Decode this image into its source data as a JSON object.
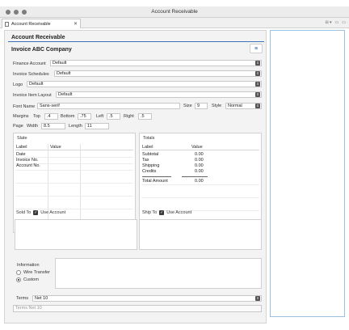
{
  "window": {
    "title": "Account Receivable"
  },
  "tab": {
    "label": "Account Receivable",
    "close": "✕"
  },
  "tabtools": [
    "⊟ ▾",
    "▭",
    "▭"
  ],
  "section": {
    "title": "Account Receivable"
  },
  "company": "Invoice ABC Company",
  "form": {
    "finance_account": {
      "label": "Finance Account",
      "value": "Default"
    },
    "invoice_schedules": {
      "label": "Invoice Schedules",
      "value": "Default"
    },
    "logo": {
      "label": "Logo",
      "value": "Default"
    },
    "invoice_item_layout": {
      "label": "Invoice Item Layout",
      "value": "Default"
    }
  },
  "font": {
    "name_label": "Font Name",
    "name_value": "Sans-serif",
    "size_label": "Size",
    "size_value": "9",
    "style_label": "Style",
    "style_value": "Normal"
  },
  "margins": {
    "label": "Margins",
    "top_label": "Top",
    "top_value": ".4",
    "bottom_label": "Bottom",
    "bottom_value": ".75",
    "left_label": "Left",
    "left_value": ".5",
    "right_label": "Right",
    "right_value": ".5"
  },
  "page": {
    "label": "Page",
    "width_label": "Width",
    "width_value": "8.5",
    "length_label": "Length",
    "length_value": "11"
  },
  "slate": {
    "title": "Slate",
    "columns": [
      "Label",
      "Value"
    ],
    "rows": [
      "Date",
      "Invoice No.",
      "Account No."
    ]
  },
  "totals": {
    "title": "Totals",
    "columns": [
      "Label",
      "Value"
    ],
    "rows": [
      {
        "label": "Subtotal",
        "value": "0.00"
      },
      {
        "label": "Tax",
        "value": "0.00"
      },
      {
        "label": "Shipping",
        "value": "0.00"
      },
      {
        "label": "Credits",
        "value": "0.00"
      }
    ],
    "total": {
      "label": "Total Amount",
      "value": "0.00"
    }
  },
  "sold_to": {
    "label": "Sold To",
    "checkbox_label": "Use Account",
    "checked": true
  },
  "ship_to": {
    "label": "Ship To",
    "checkbox_label": "Use Account",
    "checked": true
  },
  "information": {
    "label": "Information",
    "options": [
      {
        "label": "Wire Transfer",
        "selected": false
      },
      {
        "label": "Custom",
        "selected": true
      }
    ]
  },
  "terms": {
    "label": "Terms",
    "value": "Net 10",
    "note": "Terms Net 10"
  }
}
